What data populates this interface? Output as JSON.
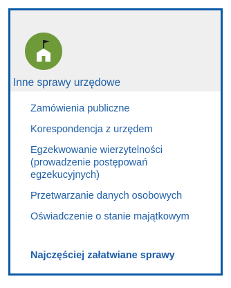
{
  "panel": {
    "icon": "school-building-with-flag-icon",
    "title": "Inne sprawy urzędowe",
    "accent_color": "#0a5aa8",
    "icon_color": "#6f9a3a",
    "header_background": "#efefef"
  },
  "links": [
    {
      "label": "Zamówienia publiczne"
    },
    {
      "label": "Korespondencja z urzędem"
    },
    {
      "label": "Egzekwowanie wierzytelności (prowadzenie postępowań egzekucyjnych)"
    },
    {
      "label": "Przetwarzanie danych osobowych"
    },
    {
      "label": "Oświadczenie o stanie majątkowym"
    }
  ],
  "footer": {
    "label": "Najczęściej załatwiane sprawy"
  }
}
